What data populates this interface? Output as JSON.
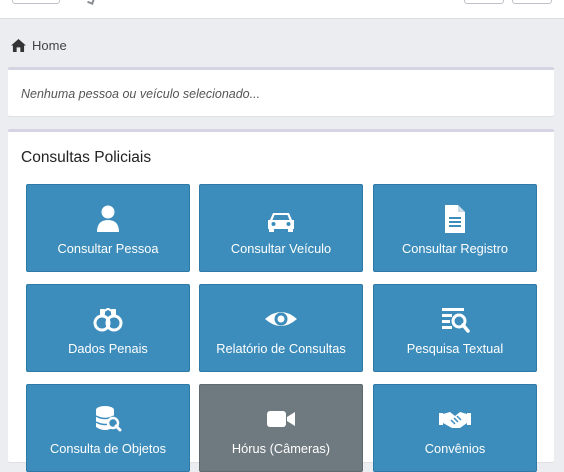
{
  "breadcrumb": {
    "home_label": "Home"
  },
  "status": {
    "message": "Nenhuma pessoa ou veículo selecionado..."
  },
  "main": {
    "title": "Consultas Policiais",
    "tiles": [
      {
        "label": "Consultar Pessoa",
        "icon": "user-icon"
      },
      {
        "label": "Consultar Veículo",
        "icon": "car-icon"
      },
      {
        "label": "Consultar Registro",
        "icon": "document-icon"
      },
      {
        "label": "Dados Penais",
        "icon": "handcuffs-icon"
      },
      {
        "label": "Relatório de Consultas",
        "icon": "eye-icon"
      },
      {
        "label": "Pesquisa Textual",
        "icon": "text-search-icon"
      },
      {
        "label": "Consulta de Objetos",
        "icon": "database-search-icon"
      },
      {
        "label": "Hórus (Câmeras)",
        "icon": "video-camera-icon"
      },
      {
        "label": "Convênios",
        "icon": "handshake-icon"
      }
    ]
  },
  "colors": {
    "tile_primary": "#3c8dbc",
    "tile_disabled": "#6f7a80",
    "page_bg": "#ecedf1"
  }
}
